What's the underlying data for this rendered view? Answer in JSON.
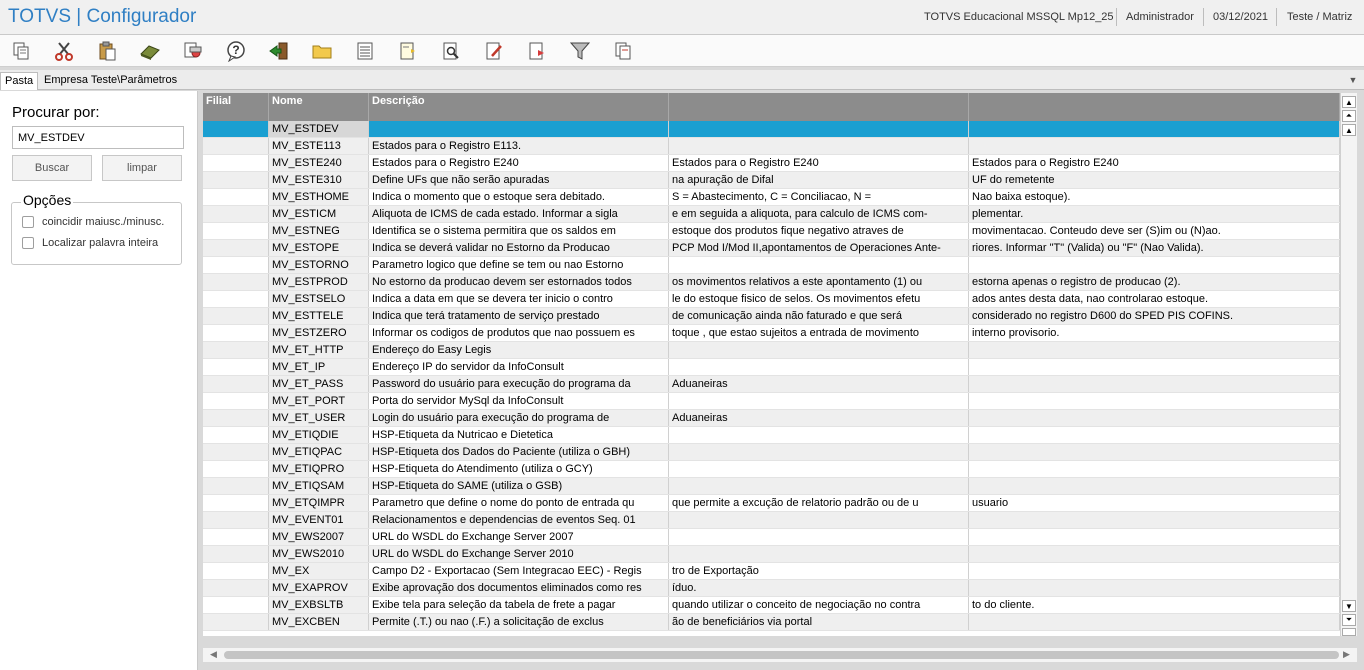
{
  "window": {
    "app_title": "TOTVS | Configurador",
    "environment": "TOTVS Educacional MSSQL Mp12_25",
    "user": "Administrador",
    "date": "03/12/2021",
    "company": "Teste / Matriz"
  },
  "toolbar": {
    "icons": [
      "copy-icon",
      "cut-icon",
      "paste-icon",
      "eraser-icon",
      "print-preview-icon",
      "help-icon",
      "exit-icon",
      "folder-icon",
      "list-icon",
      "add-document-icon",
      "search-document-icon",
      "edit-document-icon",
      "delete-document-icon",
      "filter-icon",
      "document-copy-icon"
    ]
  },
  "tabs": {
    "pasta": "Pasta",
    "path": "Empresa Teste\\Parâmetros"
  },
  "search": {
    "title": "Procurar por:",
    "value": "MV_ESTDEV",
    "search_button": "Buscar",
    "clear_button": "limpar",
    "options_title": "Opções",
    "option_match_case": "coincidir maiusc./minusc.",
    "option_whole_word": "Localizar palavra inteira"
  },
  "grid": {
    "columns": [
      "Filial",
      "Nome",
      "Descrição",
      "",
      ""
    ],
    "selected_index": 0,
    "rows": [
      {
        "filial": "",
        "nome": "MV_ESTDEV",
        "d1": "",
        "d2": "",
        "d3": ""
      },
      {
        "filial": "",
        "nome": "MV_ESTE113",
        "d1": "Estados para o Registro E113.",
        "d2": "",
        "d3": ""
      },
      {
        "filial": "",
        "nome": "MV_ESTE240",
        "d1": "Estados para o Registro E240",
        "d2": "Estados para o Registro E240",
        "d3": "Estados para o Registro E240"
      },
      {
        "filial": "",
        "nome": "MV_ESTE310",
        "d1": "Define UFs que não serão apuradas",
        "d2": "na apuração de Difal",
        "d3": "UF do remetente"
      },
      {
        "filial": "",
        "nome": "MV_ESTHOME",
        "d1": "Indica o momento que o estoque sera debitado.",
        "d2": "S = Abastecimento, C = Conciliacao, N =",
        "d3": "Nao baixa estoque)."
      },
      {
        "filial": "",
        "nome": "MV_ESTICM",
        "d1": "Aliquota de ICMS de cada estado. Informar a sigla",
        "d2": "e em seguida a aliquota, para calculo de ICMS com-",
        "d3": "plementar."
      },
      {
        "filial": "",
        "nome": "MV_ESTNEG",
        "d1": "Identifica se o sistema permitira que os saldos em",
        "d2": "estoque dos produtos fique negativo atraves de",
        "d3": "movimentacao. Conteudo deve ser (S)im ou (N)ao."
      },
      {
        "filial": "",
        "nome": "MV_ESTOPE",
        "d1": "Indica se deverá validar no Estorno da Producao",
        "d2": "PCP Mod I/Mod II,apontamentos de Operaciones Ante-",
        "d3": "riores. Informar \"T\" (Valida) ou \"F\" (Nao Valida)."
      },
      {
        "filial": "",
        "nome": "MV_ESTORNO",
        "d1": "Parametro logico que define se tem ou nao Estorno",
        "d2": "",
        "d3": ""
      },
      {
        "filial": "",
        "nome": "MV_ESTPROD",
        "d1": "No estorno da producao devem ser estornados todos",
        "d2": "os movimentos relativos a este apontamento (1) ou",
        "d3": "estorna apenas o registro de producao (2)."
      },
      {
        "filial": "",
        "nome": "MV_ESTSELO",
        "d1": "Indica a data em que se devera ter inicio o contro",
        "d2": "le do estoque fisico de selos. Os movimentos efetu",
        "d3": "ados antes desta data, nao controlarao estoque."
      },
      {
        "filial": "",
        "nome": "MV_ESTTELE",
        "d1": "Indica que terá tratamento de serviço prestado",
        "d2": "de comunicação ainda não faturado e que será",
        "d3": "considerado no registro D600 do SPED PIS COFINS."
      },
      {
        "filial": "",
        "nome": "MV_ESTZERO",
        "d1": "Informar os codigos de produtos que nao possuem es",
        "d2": "toque , que estao sujeitos a entrada de movimento",
        "d3": "interno provisorio."
      },
      {
        "filial": "",
        "nome": "MV_ET_HTTP",
        "d1": "Endereço do Easy Legis",
        "d2": "",
        "d3": ""
      },
      {
        "filial": "",
        "nome": "MV_ET_IP",
        "d1": "Endereço IP do servidor da InfoConsult",
        "d2": "",
        "d3": ""
      },
      {
        "filial": "",
        "nome": "MV_ET_PASS",
        "d1": "Password do usuário para execução do programa da",
        "d2": "Aduaneiras",
        "d3": ""
      },
      {
        "filial": "",
        "nome": "MV_ET_PORT",
        "d1": "Porta do servidor MySql da InfoConsult",
        "d2": "",
        "d3": ""
      },
      {
        "filial": "",
        "nome": "MV_ET_USER",
        "d1": "Login do usuário para execução do programa de",
        "d2": "Aduaneiras",
        "d3": ""
      },
      {
        "filial": "",
        "nome": "MV_ETIQDIE",
        "d1": "HSP-Etiqueta da Nutricao e Dietetica",
        "d2": "",
        "d3": ""
      },
      {
        "filial": "",
        "nome": "MV_ETIQPAC",
        "d1": "HSP-Etiqueta dos Dados do Paciente (utiliza o GBH)",
        "d2": "",
        "d3": ""
      },
      {
        "filial": "",
        "nome": "MV_ETIQPRO",
        "d1": "HSP-Etiqueta do Atendimento (utiliza o GCY)",
        "d2": "",
        "d3": ""
      },
      {
        "filial": "",
        "nome": "MV_ETIQSAM",
        "d1": "HSP-Etiqueta do SAME  (utiliza o GSB)",
        "d2": "",
        "d3": ""
      },
      {
        "filial": "",
        "nome": "MV_ETQIMPR",
        "d1": "Parametro que define o nome do ponto de entrada qu",
        "d2": " que permite a excução de relatorio padrão ou de u",
        "d3": "usuario"
      },
      {
        "filial": "",
        "nome": "MV_EVENT01",
        "d1": "Relacionamentos e dependencias de eventos Seq. 01",
        "d2": "",
        "d3": ""
      },
      {
        "filial": "",
        "nome": "MV_EWS2007",
        "d1": "URL do WSDL do Exchange Server 2007",
        "d2": "",
        "d3": ""
      },
      {
        "filial": "",
        "nome": "MV_EWS2010",
        "d1": "URL do WSDL do Exchange Server 2010",
        "d2": "",
        "d3": ""
      },
      {
        "filial": "",
        "nome": "MV_EX",
        "d1": "Campo D2 - Exportacao (Sem Integracao EEC) - Regis",
        "d2": "tro de Exportação",
        "d3": ""
      },
      {
        "filial": "",
        "nome": "MV_EXAPROV",
        "d1": "Exibe aprovação dos documentos eliminados como res",
        "d2": "íduo.",
        "d3": ""
      },
      {
        "filial": "",
        "nome": "MV_EXBSLTB",
        "d1": "Exibe tela para seleção da tabela de frete a pagar",
        "d2": "quando utilizar o conceito de negociação no contra",
        "d3": "to do cliente."
      },
      {
        "filial": "",
        "nome": "MV_EXCBEN",
        "d1": "Permite (.T.) ou nao (.F.) a solicitação de exclus",
        "d2": "ão de beneficiários via portal",
        "d3": ""
      }
    ]
  }
}
